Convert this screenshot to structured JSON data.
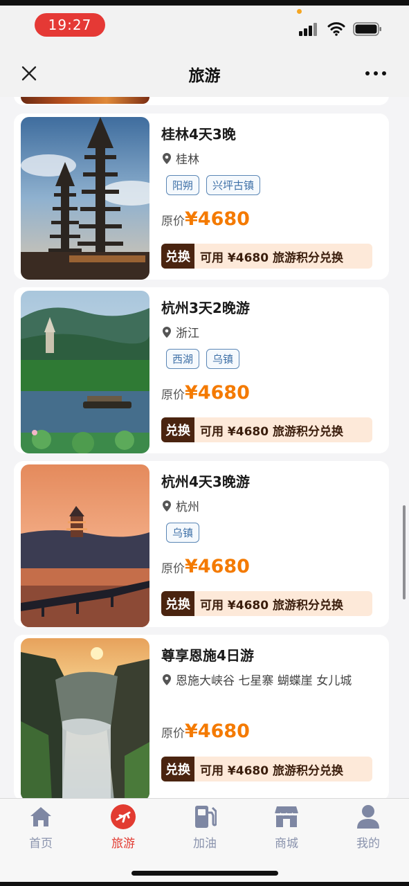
{
  "status_bar": {
    "time": "19:27",
    "icons": [
      "cellular-signal-icon",
      "wifi-icon",
      "battery-icon"
    ]
  },
  "navbar": {
    "title": "旅游",
    "close_icon": "close-icon",
    "more_icon": "more-icon"
  },
  "colors": {
    "accent_orange": "#f47a00",
    "tag_blue": "#3d6fa6",
    "exchange_badge": "#4a2410",
    "exchange_bar": "#fde9d9",
    "active_tab": "#e23b31"
  },
  "products": [
    {
      "title": "桂林4天3晚",
      "location": "桂林",
      "tags": [
        "阳朔",
        "兴坪古镇"
      ],
      "price_label": "原价",
      "price": "¥4680",
      "exchange_badge": "兑换",
      "exchange_text": "可用 ¥4680 旅游积分兑换",
      "image": "pagoda-twin-towers"
    },
    {
      "title": "杭州3天2晚游",
      "location": "浙江",
      "tags": [
        "西湖",
        "乌镇"
      ],
      "price_label": "原价",
      "price": "¥4680",
      "exchange_badge": "兑换",
      "exchange_text": "可用 ¥4680 旅游积分兑换",
      "image": "west-lake-boat"
    },
    {
      "title": "杭州4天3晚游",
      "location": "杭州",
      "tags": [
        "乌镇"
      ],
      "price_label": "原价",
      "price": "¥4680",
      "exchange_badge": "兑换",
      "exchange_text": "可用 ¥4680 旅游积分兑换",
      "image": "sunset-pagoda-bridge"
    },
    {
      "title": "尊享恩施4日游",
      "location": "恩施大峡谷 七星寨 蝴蝶崖 女儿城",
      "tags": [],
      "price_label": "原价",
      "price": "¥4680",
      "exchange_badge": "兑换",
      "exchange_text": "可用 ¥4680 旅游积分兑换",
      "image": "canyon-sunrise"
    }
  ],
  "tabbar": [
    {
      "label": "首页",
      "icon": "home-icon",
      "active": false
    },
    {
      "label": "旅游",
      "icon": "airplane-icon",
      "active": true
    },
    {
      "label": "加油",
      "icon": "fuel-pump-icon",
      "active": false
    },
    {
      "label": "商城",
      "icon": "store-icon",
      "active": false
    },
    {
      "label": "我的",
      "icon": "user-icon",
      "active": false
    }
  ]
}
